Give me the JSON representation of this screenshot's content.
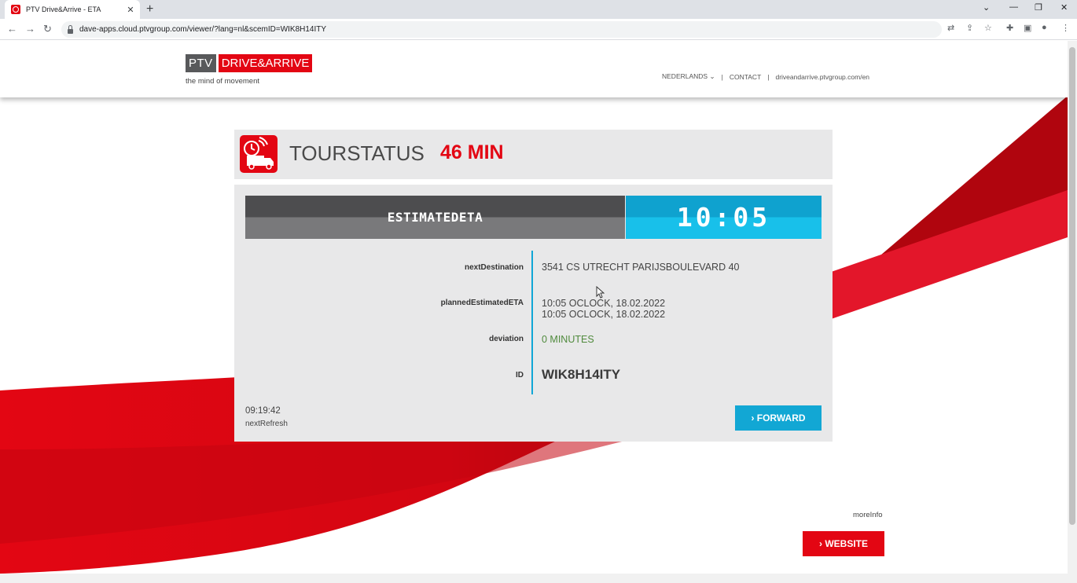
{
  "browser": {
    "tab_title": "PTV Drive&Arrive - ETA",
    "tab_close": "✕",
    "new_tab": "+",
    "url": "dave-apps.cloud.ptvgroup.com/viewer/?lang=nl&scemID=WIK8H14ITY"
  },
  "header": {
    "logo_left": "PTV",
    "logo_right": "DRIVE&ARRIVE",
    "tagline": "the mind of movement",
    "nav": [
      "NEDERLANDS",
      "CONTACT",
      "driveandarrive.ptvgroup.com/en"
    ]
  },
  "tour": {
    "title": "TOURSTATUS",
    "minutes": "46 MIN"
  },
  "eta": {
    "label": "ESTIMATEDETA",
    "time": "10:05"
  },
  "details": {
    "next_destination_label": "nextDestination",
    "next_destination_value": "3541 CS UTRECHT PARIJSBOULEVARD 40",
    "planned_label": "plannedEstimatedETA",
    "planned_value_1": "10:05 OCLOCK, 18.02.2022",
    "planned_value_2": "10:05 OCLOCK, 18.02.2022",
    "deviation_label": "deviation",
    "deviation_value": "0 MINUTES",
    "id_label": "ID",
    "id_value": "WIK8H14ITY"
  },
  "refresh": {
    "time": "09:19:42",
    "label": "nextRefresh"
  },
  "buttons": {
    "forward": "› FORWARD",
    "more_info": "moreInfo",
    "website": "› WEBSITE"
  },
  "colors": {
    "brand_red": "#e30613",
    "accent_blue": "#12a7d4",
    "deviation_green": "#4f8a3c"
  }
}
